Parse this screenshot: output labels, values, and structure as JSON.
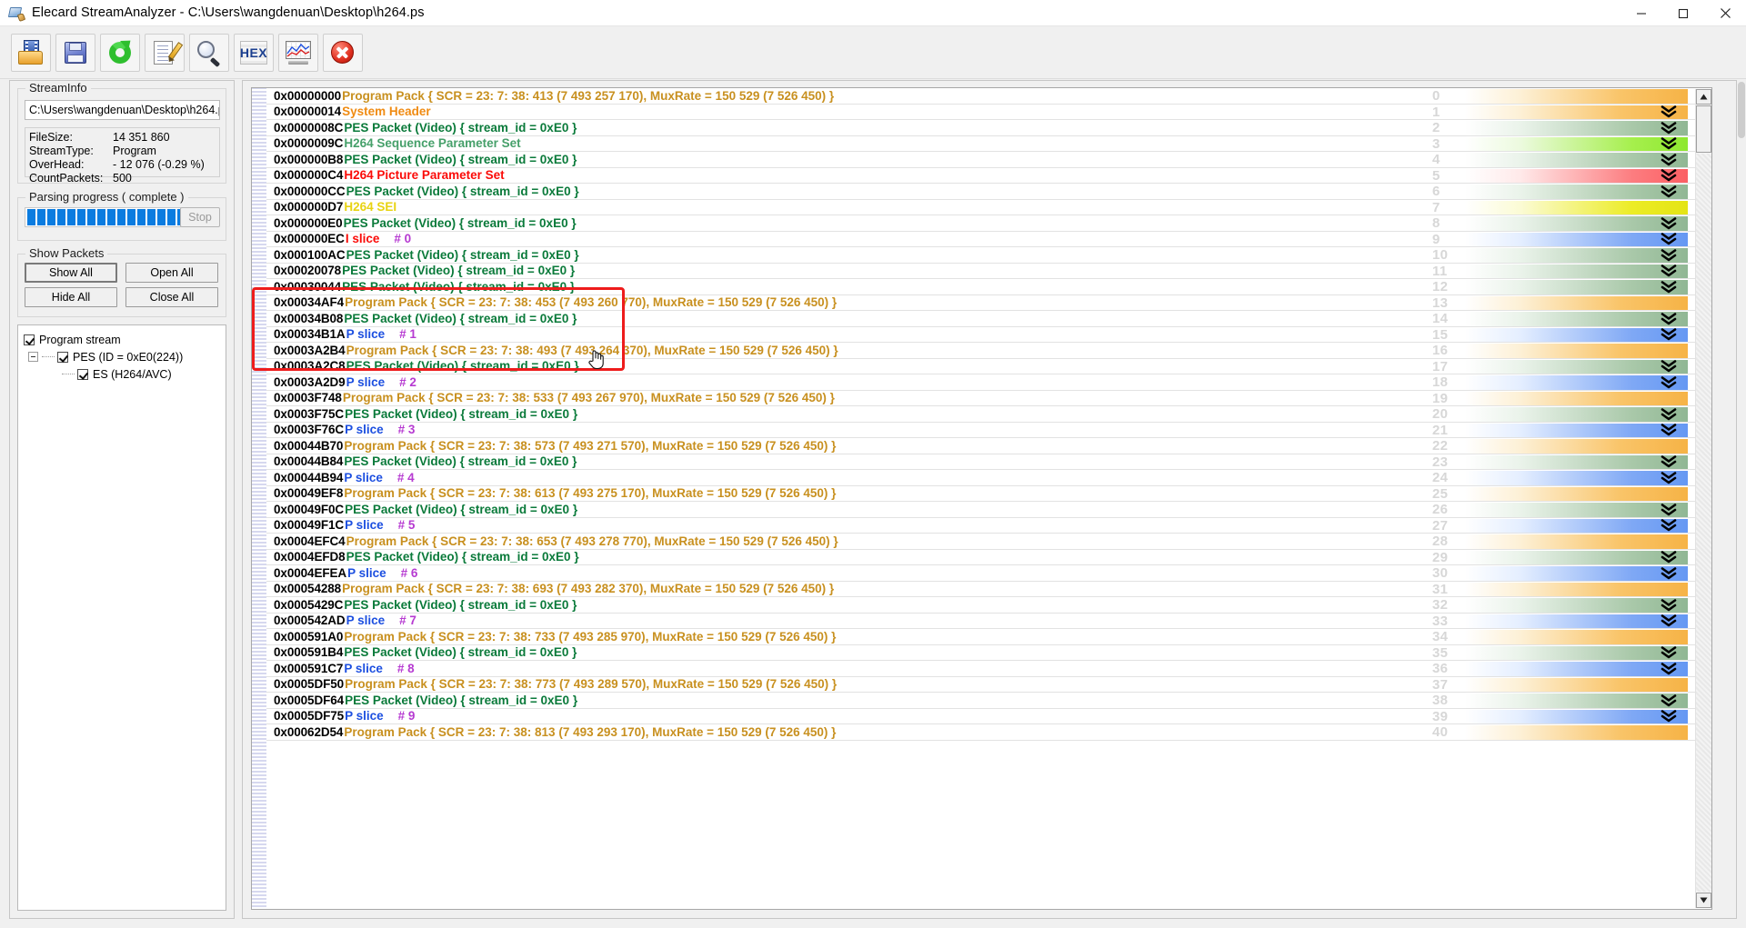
{
  "window": {
    "title": "Elecard StreamAnalyzer - C:\\Users\\wangdenuan\\Desktop\\h264.ps",
    "app_icon": "stream-analyzer-icon",
    "controls": {
      "minimize": "minimize-icon",
      "maximize": "maximize-icon",
      "close": "close-icon"
    }
  },
  "toolbar": {
    "buttons": [
      {
        "name": "open-file-button",
        "icon": "open-folder-film-icon",
        "title": "Open"
      },
      {
        "name": "save-button",
        "icon": "floppy-disk-icon",
        "title": "Save"
      },
      {
        "name": "refresh-button",
        "icon": "green-refresh-icon",
        "title": "Refresh"
      },
      {
        "name": "report-button",
        "icon": "document-pencil-icon",
        "title": "Report"
      },
      {
        "name": "search-button",
        "icon": "magnifier-icon",
        "title": "Search"
      },
      {
        "name": "hex-view-button",
        "icon": "hex-icon",
        "title": "HEX",
        "label": "HEX"
      },
      {
        "name": "chart-button",
        "icon": "chart-monitor-icon",
        "title": "Charts"
      },
      {
        "name": "close-stream-button",
        "icon": "red-x-circle-icon",
        "title": "Close"
      }
    ]
  },
  "sidebar": {
    "streaminfo": {
      "title": "StreamInfo",
      "path": "C:\\Users\\wangdenuan\\Desktop\\h264.ps",
      "fields": [
        {
          "key": "FileSize:",
          "value": "14 351 860"
        },
        {
          "key": "StreamType:",
          "value": "Program"
        },
        {
          "key": "OverHead:",
          "value": "- 12 076 (-0.29 %)"
        },
        {
          "key": "CountPackets:",
          "value": "500"
        }
      ]
    },
    "parsing": {
      "title": "Parsing progress ( complete )",
      "stop_label": "Stop",
      "blocks": 16
    },
    "show_packets": {
      "title": "Show Packets",
      "buttons": [
        {
          "name": "show-all-button",
          "label": "Show All"
        },
        {
          "name": "open-all-button",
          "label": "Open All"
        },
        {
          "name": "hide-all-button",
          "label": "Hide All"
        },
        {
          "name": "close-all-button",
          "label": "Close All"
        }
      ]
    },
    "tree": [
      {
        "label": "Program stream",
        "checked": true,
        "level": 0,
        "expander": false
      },
      {
        "label": "PES (ID = 0xE0(224))",
        "checked": true,
        "level": 1,
        "expander": true
      },
      {
        "label": "ES (H264/AVC)",
        "checked": true,
        "level": 2,
        "expander": false
      }
    ]
  },
  "annotation": {
    "name": "red-highlight-rectangle",
    "color": "#ee1c1c"
  },
  "cursor": {
    "name": "hand-pointer-cursor"
  },
  "scrollbar": {
    "up": "scroll-up-arrow",
    "down": "scroll-down-arrow"
  },
  "list": {
    "rows": [
      {
        "n": "0",
        "addr": "0x00000000",
        "desc": "Program Pack { SCR = 23:  7: 38: 413 (7 493 257 170), MuxRate = 150 529 (7 526 450) }",
        "cls": "c-prog",
        "bar": "g-orange",
        "chev": false
      },
      {
        "n": "1",
        "addr": "0x00000014",
        "desc": "System Header",
        "cls": "c-sys",
        "bar": "g-orange",
        "chev": true
      },
      {
        "n": "2",
        "addr": "0x0000008C",
        "desc": "PES Packet (Video) { stream_id = 0xE0 }",
        "cls": "c-pes",
        "bar": "g-green",
        "chev": true
      },
      {
        "n": "3",
        "addr": "0x0000009C",
        "desc": "H264 Sequence Parameter Set",
        "cls": "c-sps",
        "bar": "g-lgreen",
        "chev": true
      },
      {
        "n": "4",
        "addr": "0x000000B8",
        "desc": "PES Packet (Video) { stream_id = 0xE0 }",
        "cls": "c-pes",
        "bar": "g-green",
        "chev": true
      },
      {
        "n": "5",
        "addr": "0x000000C4",
        "desc": "H264 Picture Parameter Set",
        "cls": "c-pps",
        "bar": "g-red",
        "chev": true
      },
      {
        "n": "6",
        "addr": "0x000000CC",
        "desc": "PES Packet (Video) { stream_id = 0xE0 }",
        "cls": "c-pes",
        "bar": "g-green",
        "chev": true
      },
      {
        "n": "7",
        "addr": "0x000000D7",
        "desc": "H264 SEI",
        "cls": "c-sei",
        "bar": "g-yellow",
        "chev": false
      },
      {
        "n": "8",
        "addr": "0x000000E0",
        "desc": "PES Packet (Video) { stream_id = 0xE0 }",
        "cls": "c-pes",
        "bar": "g-green",
        "chev": true
      },
      {
        "n": "9",
        "addr": "0x000000EC",
        "desc": "I slice",
        "cls": "c-islice",
        "num": "# 0",
        "bar": "g-blue",
        "chev": true
      },
      {
        "n": "10",
        "addr": "0x000100AC",
        "desc": "PES Packet (Video) { stream_id = 0xE0 }",
        "cls": "c-pes",
        "bar": "g-green",
        "chev": true
      },
      {
        "n": "11",
        "addr": "0x00020078",
        "desc": "PES Packet (Video) { stream_id = 0xE0 }",
        "cls": "c-pes",
        "bar": "g-green",
        "chev": true
      },
      {
        "n": "12",
        "addr": "0x00030044",
        "desc": "PES Packet (Video) { stream_id = 0xE0 }",
        "cls": "c-pes",
        "bar": "g-green",
        "chev": true
      },
      {
        "n": "13",
        "addr": "0x00034AF4",
        "desc": "Program Pack { SCR = 23:  7: 38: 453 (7 493 260 770), MuxRate = 150 529 (7 526 450) }",
        "cls": "c-prog",
        "bar": "g-orange",
        "chev": false
      },
      {
        "n": "14",
        "addr": "0x00034B08",
        "desc": "PES Packet (Video) { stream_id = 0xE0 }",
        "cls": "c-pes",
        "bar": "g-green",
        "chev": true
      },
      {
        "n": "15",
        "addr": "0x00034B1A",
        "desc": "P slice",
        "cls": "c-pslice",
        "num": "# 1",
        "bar": "g-blue",
        "chev": true
      },
      {
        "n": "16",
        "addr": "0x0003A2B4",
        "desc": "Program Pack { SCR = 23:  7: 38: 493 (7 493 264 370), MuxRate = 150 529 (7 526 450) }",
        "cls": "c-prog",
        "bar": "g-orange",
        "chev": false
      },
      {
        "n": "17",
        "addr": "0x0003A2C8",
        "desc": "PES Packet (Video) { stream_id = 0xE0 }",
        "cls": "c-pes",
        "bar": "g-green",
        "chev": true
      },
      {
        "n": "18",
        "addr": "0x0003A2D9",
        "desc": "P slice",
        "cls": "c-pslice",
        "num": "# 2",
        "bar": "g-blue",
        "chev": true
      },
      {
        "n": "19",
        "addr": "0x0003F748",
        "desc": "Program Pack { SCR = 23:  7: 38: 533 (7 493 267 970), MuxRate = 150 529 (7 526 450) }",
        "cls": "c-prog",
        "bar": "g-orange",
        "chev": false
      },
      {
        "n": "20",
        "addr": "0x0003F75C",
        "desc": "PES Packet (Video) { stream_id = 0xE0 }",
        "cls": "c-pes",
        "bar": "g-green",
        "chev": true
      },
      {
        "n": "21",
        "addr": "0x0003F76C",
        "desc": "P slice",
        "cls": "c-pslice",
        "num": "# 3",
        "bar": "g-blue",
        "chev": true
      },
      {
        "n": "22",
        "addr": "0x00044B70",
        "desc": "Program Pack { SCR = 23:  7: 38: 573 (7 493 271 570), MuxRate = 150 529 (7 526 450) }",
        "cls": "c-prog",
        "bar": "g-orange",
        "chev": false
      },
      {
        "n": "23",
        "addr": "0x00044B84",
        "desc": "PES Packet (Video) { stream_id = 0xE0 }",
        "cls": "c-pes",
        "bar": "g-green",
        "chev": true
      },
      {
        "n": "24",
        "addr": "0x00044B94",
        "desc": "P slice",
        "cls": "c-pslice",
        "num": "# 4",
        "bar": "g-blue",
        "chev": true
      },
      {
        "n": "25",
        "addr": "0x00049EF8",
        "desc": "Program Pack { SCR = 23:  7: 38: 613 (7 493 275 170), MuxRate = 150 529 (7 526 450) }",
        "cls": "c-prog",
        "bar": "g-orange",
        "chev": false
      },
      {
        "n": "26",
        "addr": "0x00049F0C",
        "desc": "PES Packet (Video) { stream_id = 0xE0 }",
        "cls": "c-pes",
        "bar": "g-green",
        "chev": true
      },
      {
        "n": "27",
        "addr": "0x00049F1C",
        "desc": "P slice",
        "cls": "c-pslice",
        "num": "# 5",
        "bar": "g-blue",
        "chev": true
      },
      {
        "n": "28",
        "addr": "0x0004EFC4",
        "desc": "Program Pack { SCR = 23:  7: 38: 653 (7 493 278 770), MuxRate = 150 529 (7 526 450) }",
        "cls": "c-prog",
        "bar": "g-orange",
        "chev": false
      },
      {
        "n": "29",
        "addr": "0x0004EFD8",
        "desc": "PES Packet (Video) { stream_id = 0xE0 }",
        "cls": "c-pes",
        "bar": "g-green",
        "chev": true
      },
      {
        "n": "30",
        "addr": "0x0004EFEA",
        "desc": "P slice",
        "cls": "c-pslice",
        "num": "# 6",
        "bar": "g-blue",
        "chev": true
      },
      {
        "n": "31",
        "addr": "0x00054288",
        "desc": "Program Pack { SCR = 23:  7: 38: 693 (7 493 282 370), MuxRate = 150 529 (7 526 450) }",
        "cls": "c-prog",
        "bar": "g-orange",
        "chev": false
      },
      {
        "n": "32",
        "addr": "0x0005429C",
        "desc": "PES Packet (Video) { stream_id = 0xE0 }",
        "cls": "c-pes",
        "bar": "g-green",
        "chev": true
      },
      {
        "n": "33",
        "addr": "0x000542AD",
        "desc": "P slice",
        "cls": "c-pslice",
        "num": "# 7",
        "bar": "g-blue",
        "chev": true
      },
      {
        "n": "34",
        "addr": "0x000591A0",
        "desc": "Program Pack { SCR = 23:  7: 38: 733 (7 493 285 970), MuxRate = 150 529 (7 526 450) }",
        "cls": "c-prog",
        "bar": "g-orange",
        "chev": false
      },
      {
        "n": "35",
        "addr": "0x000591B4",
        "desc": "PES Packet (Video) { stream_id = 0xE0 }",
        "cls": "c-pes",
        "bar": "g-green",
        "chev": true
      },
      {
        "n": "36",
        "addr": "0x000591C7",
        "desc": "P slice",
        "cls": "c-pslice",
        "num": "# 8",
        "bar": "g-blue",
        "chev": true
      },
      {
        "n": "37",
        "addr": "0x0005DF50",
        "desc": "Program Pack { SCR = 23:  7: 38: 773 (7 493 289 570), MuxRate = 150 529 (7 526 450) }",
        "cls": "c-prog",
        "bar": "g-orange",
        "chev": false
      },
      {
        "n": "38",
        "addr": "0x0005DF64",
        "desc": "PES Packet (Video) { stream_id = 0xE0 }",
        "cls": "c-pes",
        "bar": "g-green",
        "chev": true
      },
      {
        "n": "39",
        "addr": "0x0005DF75",
        "desc": "P slice",
        "cls": "c-pslice",
        "num": "# 9",
        "bar": "g-blue",
        "chev": true
      },
      {
        "n": "40",
        "addr": "0x00062D54",
        "desc": "Program Pack { SCR = 23:  7: 38: 813 (7 493 293 170), MuxRate = 150 529 (7 526 450) }",
        "cls": "c-prog",
        "bar": "g-orange",
        "chev": false
      }
    ]
  }
}
